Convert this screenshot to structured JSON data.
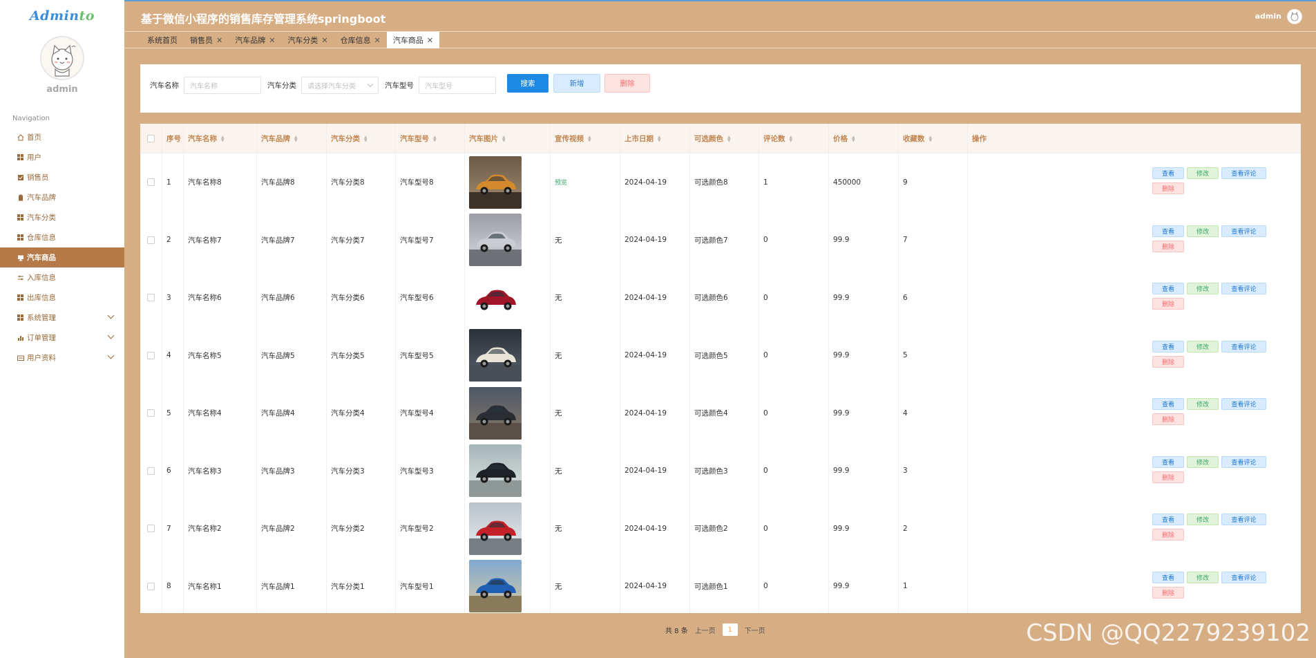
{
  "brand": {
    "text_a": "Admin",
    "text_b": "to"
  },
  "sidebar": {
    "username": "admin",
    "nav_title": "Navigation",
    "items": [
      {
        "label": "首页",
        "icon": "home-icon",
        "active": false,
        "has_caret": false
      },
      {
        "label": "用户",
        "icon": "grid-icon",
        "active": false,
        "has_caret": false
      },
      {
        "label": "销售员",
        "icon": "checkbox-icon",
        "active": false,
        "has_caret": false
      },
      {
        "label": "汽车品牌",
        "icon": "clipboard-icon",
        "active": false,
        "has_caret": false
      },
      {
        "label": "汽车分类",
        "icon": "grid-icon",
        "active": false,
        "has_caret": false
      },
      {
        "label": "仓库信息",
        "icon": "grid-icon",
        "active": false,
        "has_caret": false
      },
      {
        "label": "汽车商品",
        "icon": "monitor-icon",
        "active": true,
        "has_caret": false
      },
      {
        "label": "入库信息",
        "icon": "sliders-icon",
        "active": false,
        "has_caret": false
      },
      {
        "label": "出库信息",
        "icon": "grid-icon",
        "active": false,
        "has_caret": false
      },
      {
        "label": "系统管理",
        "icon": "grid-icon",
        "active": false,
        "has_caret": true
      },
      {
        "label": "订单管理",
        "icon": "bar-chart-icon",
        "active": false,
        "has_caret": true
      },
      {
        "label": "用户资料",
        "icon": "id-card-icon",
        "active": false,
        "has_caret": true
      }
    ]
  },
  "header": {
    "title": "基于微信小程序的销售库存管理系统springboot",
    "user": "admin"
  },
  "tabs": [
    {
      "label": "系统首页",
      "closable": false,
      "active": false
    },
    {
      "label": "销售员",
      "closable": true,
      "active": false
    },
    {
      "label": "汽车品牌",
      "closable": true,
      "active": false
    },
    {
      "label": "汽车分类",
      "closable": true,
      "active": false
    },
    {
      "label": "仓库信息",
      "closable": true,
      "active": false
    },
    {
      "label": "汽车商品",
      "closable": true,
      "active": true
    }
  ],
  "search": {
    "name_label": "汽车名称",
    "name_placeholder": "汽车名称",
    "category_label": "汽车分类",
    "category_placeholder": "请选择汽车分类",
    "model_label": "汽车型号",
    "model_placeholder": "汽车型号",
    "search_button": "搜索",
    "add_button": "新增",
    "delete_button": "删除"
  },
  "table": {
    "columns": [
      "序号",
      "汽车名称",
      "汽车品牌",
      "汽车分类",
      "汽车型号",
      "汽车图片",
      "宣传视频",
      "上市日期",
      "可选颜色",
      "评论数",
      "价格",
      "收藏数",
      "操作"
    ],
    "sortable": [
      false,
      true,
      true,
      true,
      true,
      true,
      true,
      true,
      true,
      true,
      true,
      true,
      false
    ],
    "rows": [
      {
        "idx": "1",
        "name": "汽车名称8",
        "brand": "汽车品牌8",
        "category": "汽车分类8",
        "model": "汽车型号8",
        "image": "orange-suv",
        "video": "预览",
        "date": "2024-04-19",
        "color": "可选颜色8",
        "comments": "1",
        "price": "450000",
        "favs": "9"
      },
      {
        "idx": "2",
        "name": "汽车名称7",
        "brand": "汽车品牌7",
        "category": "汽车分类7",
        "model": "汽车型号7",
        "image": "silver-concept",
        "video": "无",
        "date": "2024-04-19",
        "color": "可选颜色7",
        "comments": "0",
        "price": "99.9",
        "favs": "7"
      },
      {
        "idx": "3",
        "name": "汽车名称6",
        "brand": "汽车品牌6",
        "category": "汽车分类6",
        "model": "汽车型号6",
        "image": "red-sedan",
        "video": "无",
        "date": "2024-04-19",
        "color": "可选颜色6",
        "comments": "0",
        "price": "99.9",
        "favs": "6"
      },
      {
        "idx": "4",
        "name": "汽车名称5",
        "brand": "汽车品牌5",
        "category": "汽车分类5",
        "model": "汽车型号5",
        "image": "white-suv",
        "video": "无",
        "date": "2024-04-19",
        "color": "可选颜色5",
        "comments": "0",
        "price": "99.9",
        "favs": "5"
      },
      {
        "idx": "5",
        "name": "汽车名称4",
        "brand": "汽车品牌4",
        "category": "汽车分类4",
        "model": "汽车型号4",
        "image": "dark-suv",
        "video": "无",
        "date": "2024-04-19",
        "color": "可选颜色4",
        "comments": "0",
        "price": "99.9",
        "favs": "4"
      },
      {
        "idx": "6",
        "name": "汽车名称3",
        "brand": "汽车品牌3",
        "category": "汽车分类3",
        "model": "汽车型号3",
        "image": "black-suv",
        "video": "无",
        "date": "2024-04-19",
        "color": "可选颜色3",
        "comments": "0",
        "price": "99.9",
        "favs": "3"
      },
      {
        "idx": "7",
        "name": "汽车名称2",
        "brand": "汽车品牌2",
        "category": "汽车分类2",
        "model": "汽车型号2",
        "image": "red-sports",
        "video": "无",
        "date": "2024-04-19",
        "color": "可选颜色2",
        "comments": "0",
        "price": "99.9",
        "favs": "2"
      },
      {
        "idx": "8",
        "name": "汽车名称1",
        "brand": "汽车品牌1",
        "category": "汽车分类1",
        "model": "汽车型号1",
        "image": "blue-suv",
        "video": "无",
        "date": "2024-04-19",
        "color": "可选颜色1",
        "comments": "0",
        "price": "99.9",
        "favs": "1"
      }
    ],
    "ops": {
      "view": "查看",
      "edit": "修改",
      "review": "查看评论",
      "delete": "删除"
    }
  },
  "pager": {
    "total": "共 8 条",
    "prev": "上一页",
    "current": "1",
    "next": "下一页"
  },
  "watermark": "CSDN @QQ2279239102",
  "colors": {
    "sidebar_active": "#b57a47",
    "background": "#d7ad84",
    "primary": "#1e88e5",
    "danger": "#f56c6c",
    "success": "#3aa76d"
  }
}
